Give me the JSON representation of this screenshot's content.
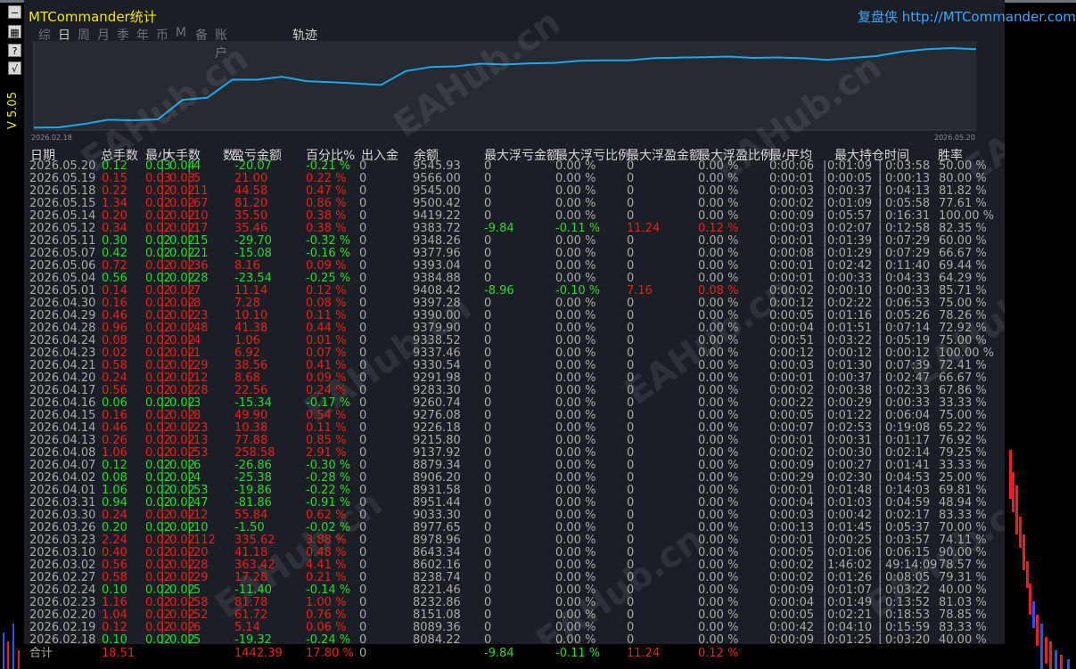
{
  "app": {
    "title": "MTCommander统计",
    "site": "复盘侠 http://MTCommander.com",
    "version": "V 5.05"
  },
  "toolbar": {
    "buttons": [
      {
        "name": "minimize-button",
        "glyph": "−"
      },
      {
        "name": "grid-button",
        "glyph": "▦"
      },
      {
        "name": "help-button",
        "glyph": "?"
      },
      {
        "name": "chart-button",
        "glyph": "√"
      }
    ]
  },
  "nav": {
    "tabs": [
      "综",
      "日",
      "周",
      "月",
      "季",
      "年",
      "币",
      "M",
      "备",
      "账户"
    ],
    "active_index": 1
  },
  "chart_data": {
    "type": "line",
    "title": "轨迹",
    "x_start_label": "2026.02.18",
    "x_end_label": "2026.05.20",
    "ylim": [
      8040,
      9600
    ],
    "series": [
      {
        "color": "#1aa8f0",
        "values": [
          8084.22,
          8089.36,
          8151.08,
          8232.86,
          8221.46,
          8238.74,
          8602.16,
          8643.34,
          8978.96,
          8977.65,
          9033.3,
          8951.44,
          8931.58,
          8906.2,
          8879.34,
          9137.92,
          9215.8,
          9226.18,
          9276.08,
          9260.74,
          9283.3,
          9291.98,
          9330.54,
          9337.46,
          9338.52,
          9379.9,
          9390.0,
          9397.28,
          9408.42,
          9384.88,
          9393.04,
          9377.96,
          9348.26,
          9383.72,
          9419.22,
          9500.42,
          9545.0,
          9566.0,
          9545.93
        ]
      }
    ]
  },
  "table": {
    "headers": [
      "日期",
      "总手数",
      "最小",
      "大手数",
      "数",
      "盈亏金额",
      "百分比%",
      "出入金",
      "余额",
      "最大浮亏金额",
      "最大浮亏比例",
      "最大浮盈金额",
      "最大浮盈比例",
      "最小",
      "平均",
      "最大持仓时间",
      "胜率"
    ],
    "rows": [
      {
        "date": "2026.05.20",
        "lots": "0.12",
        "min": "0.03",
        "max": "0.04",
        "n": "4",
        "pnl": "-20.07",
        "pct": "-0.21 %",
        "io": "0",
        "bal": "9545.93",
        "fl": "0",
        "flp": "0.00 %",
        "fp": "0",
        "fpp": "0.00 %",
        "tmin": "0:00:06",
        "tavg": "0:01:09",
        "tmax": "0:03:58",
        "win": "50.00 %",
        "c": "g"
      },
      {
        "date": "2026.05.19",
        "lots": "0.15",
        "min": "0.03",
        "max": "0.03",
        "n": "5",
        "pnl": "21.00",
        "pct": "0.22 %",
        "io": "0",
        "bal": "9566.00",
        "fl": "0",
        "flp": "0.00 %",
        "fp": "0",
        "fpp": "0.00 %",
        "tmin": "0:00:01",
        "tavg": "0:00:05",
        "tmax": "0:00:13",
        "win": "80.00 %",
        "c": "r"
      },
      {
        "date": "2026.05.18",
        "lots": "0.22",
        "min": "0.02",
        "max": "0.02",
        "n": "11",
        "pnl": "44.58",
        "pct": "0.47 %",
        "io": "0",
        "bal": "9545.00",
        "fl": "0",
        "flp": "0.00 %",
        "fp": "0",
        "fpp": "0.00 %",
        "tmin": "0:00:03",
        "tavg": "0:00:37",
        "tmax": "0:04:13",
        "win": "81.82 %",
        "c": "r"
      },
      {
        "date": "2026.05.15",
        "lots": "1.34",
        "min": "0.02",
        "max": "0.02",
        "n": "67",
        "pnl": "81.20",
        "pct": "0.86 %",
        "io": "0",
        "bal": "9500.42",
        "fl": "0",
        "flp": "0.00 %",
        "fp": "0",
        "fpp": "0.00 %",
        "tmin": "0:00:02",
        "tavg": "0:01:09",
        "tmax": "0:05:58",
        "win": "77.61 %",
        "c": "r"
      },
      {
        "date": "2026.05.14",
        "lots": "0.20",
        "min": "0.02",
        "max": "0.02",
        "n": "10",
        "pnl": "35.50",
        "pct": "0.38 %",
        "io": "0",
        "bal": "9419.22",
        "fl": "0",
        "flp": "0.00 %",
        "fp": "0",
        "fpp": "0.00 %",
        "tmin": "0:00:09",
        "tavg": "0:05:57",
        "tmax": "0:16:31",
        "win": "100.00 %",
        "c": "r"
      },
      {
        "date": "2026.05.12",
        "lots": "0.34",
        "min": "0.02",
        "max": "0.02",
        "n": "17",
        "pnl": "35.46",
        "pct": "0.38 %",
        "io": "0",
        "bal": "9383.72",
        "fl": "-9.84",
        "flp": "-0.11 %",
        "fp": "11.24",
        "fpp": "0.12 %",
        "tmin": "0:00:03",
        "tavg": "0:02:07",
        "tmax": "0:12:58",
        "win": "82.35 %",
        "c": "r"
      },
      {
        "date": "2026.05.11",
        "lots": "0.30",
        "min": "0.02",
        "max": "0.02",
        "n": "15",
        "pnl": "-29.70",
        "pct": "-0.32 %",
        "io": "0",
        "bal": "9348.26",
        "fl": "0",
        "flp": "0.00 %",
        "fp": "0",
        "fpp": "0.00 %",
        "tmin": "0:00:01",
        "tavg": "0:01:39",
        "tmax": "0:07:29",
        "win": "60.00 %",
        "c": "g"
      },
      {
        "date": "2026.05.07",
        "lots": "0.42",
        "min": "0.02",
        "max": "0.02",
        "n": "21",
        "pnl": "-15.08",
        "pct": "-0.16 %",
        "io": "0",
        "bal": "9377.96",
        "fl": "0",
        "flp": "0.00 %",
        "fp": "0",
        "fpp": "0.00 %",
        "tmin": "0:00:08",
        "tavg": "0:01:29",
        "tmax": "0:07:29",
        "win": "66.67 %",
        "c": "g"
      },
      {
        "date": "2026.05.06",
        "lots": "0.72",
        "min": "0.02",
        "max": "0.02",
        "n": "36",
        "pnl": "8.16",
        "pct": "0.09 %",
        "io": "0",
        "bal": "9393.04",
        "fl": "0",
        "flp": "0.00 %",
        "fp": "0",
        "fpp": "0.00 %",
        "tmin": "0:00:01",
        "tavg": "0:02:42",
        "tmax": "0:11:40",
        "win": "69.44 %",
        "c": "r"
      },
      {
        "date": "2026.05.04",
        "lots": "0.56",
        "min": "0.02",
        "max": "0.02",
        "n": "28",
        "pnl": "-23.54",
        "pct": "-0.25 %",
        "io": "0",
        "bal": "9384.88",
        "fl": "0",
        "flp": "0.00 %",
        "fp": "0",
        "fpp": "0.00 %",
        "tmin": "0:00:01",
        "tavg": "0:00:33",
        "tmax": "0:04:33",
        "win": "64.29 %",
        "c": "g"
      },
      {
        "date": "2026.05.01",
        "lots": "0.14",
        "min": "0.02",
        "max": "0.02",
        "n": "7",
        "pnl": "11.14",
        "pct": "0.12 %",
        "io": "0",
        "bal": "9408.42",
        "fl": "-8.96",
        "flp": "-0.10 %",
        "fp": "7.16",
        "fpp": "0.08 %",
        "tmin": "0:00:02",
        "tavg": "0:00:10",
        "tmax": "0:00:33",
        "win": "85.71 %",
        "c": "r"
      },
      {
        "date": "2026.04.30",
        "lots": "0.16",
        "min": "0.02",
        "max": "0.02",
        "n": "8",
        "pnl": "7.28",
        "pct": "0.08 %",
        "io": "0",
        "bal": "9397.28",
        "fl": "0",
        "flp": "0.00 %",
        "fp": "0",
        "fpp": "0.00 %",
        "tmin": "0:00:12",
        "tavg": "0:02:22",
        "tmax": "0:06:53",
        "win": "75.00 %",
        "c": "r"
      },
      {
        "date": "2026.04.29",
        "lots": "0.46",
        "min": "0.02",
        "max": "0.02",
        "n": "23",
        "pnl": "10.10",
        "pct": "0.11 %",
        "io": "0",
        "bal": "9390.00",
        "fl": "0",
        "flp": "0.00 %",
        "fp": "0",
        "fpp": "0.00 %",
        "tmin": "0:00:05",
        "tavg": "0:01:16",
        "tmax": "0:05:26",
        "win": "78.26 %",
        "c": "r"
      },
      {
        "date": "2026.04.28",
        "lots": "0.96",
        "min": "0.02",
        "max": "0.02",
        "n": "48",
        "pnl": "41.38",
        "pct": "0.44 %",
        "io": "0",
        "bal": "9379.90",
        "fl": "0",
        "flp": "0.00 %",
        "fp": "0",
        "fpp": "0.00 %",
        "tmin": "0:00:04",
        "tavg": "0:01:51",
        "tmax": "0:07:14",
        "win": "72.92 %",
        "c": "r"
      },
      {
        "date": "2026.04.24",
        "lots": "0.08",
        "min": "0.02",
        "max": "0.02",
        "n": "4",
        "pnl": "1.06",
        "pct": "0.01 %",
        "io": "0",
        "bal": "9338.52",
        "fl": "0",
        "flp": "0.00 %",
        "fp": "0",
        "fpp": "0.00 %",
        "tmin": "0:00:51",
        "tavg": "0:03:22",
        "tmax": "0:05:19",
        "win": "75.00 %",
        "c": "r"
      },
      {
        "date": "2026.04.23",
        "lots": "0.02",
        "min": "0.02",
        "max": "0.02",
        "n": "1",
        "pnl": "6.92",
        "pct": "0.07 %",
        "io": "0",
        "bal": "9337.46",
        "fl": "0",
        "flp": "0.00 %",
        "fp": "0",
        "fpp": "0.00 %",
        "tmin": "0:00:12",
        "tavg": "0:00:12",
        "tmax": "0:00:12",
        "win": "100.00 %",
        "c": "r"
      },
      {
        "date": "2026.04.21",
        "lots": "0.58",
        "min": "0.02",
        "max": "0.02",
        "n": "29",
        "pnl": "38.56",
        "pct": "0.41 %",
        "io": "0",
        "bal": "9330.54",
        "fl": "0",
        "flp": "0.00 %",
        "fp": "0",
        "fpp": "0.00 %",
        "tmin": "0:00:03",
        "tavg": "0:01:30",
        "tmax": "0:07:39",
        "win": "72.41 %",
        "c": "r"
      },
      {
        "date": "2026.04.20",
        "lots": "0.24",
        "min": "0.02",
        "max": "0.02",
        "n": "12",
        "pnl": "8.68",
        "pct": "0.09 %",
        "io": "0",
        "bal": "9291.98",
        "fl": "0",
        "flp": "0.00 %",
        "fp": "0",
        "fpp": "0.00 %",
        "tmin": "0:00:01",
        "tavg": "0:00:37",
        "tmax": "0:02:47",
        "win": "66.67 %",
        "c": "r"
      },
      {
        "date": "2026.04.17",
        "lots": "0.56",
        "min": "0.02",
        "max": "0.02",
        "n": "28",
        "pnl": "22.56",
        "pct": "0.24 %",
        "io": "0",
        "bal": "9283.30",
        "fl": "0",
        "flp": "0.00 %",
        "fp": "0",
        "fpp": "0.00 %",
        "tmin": "0:00:02",
        "tavg": "0:00:38",
        "tmax": "0:02:33",
        "win": "67.86 %",
        "c": "r"
      },
      {
        "date": "2026.04.16",
        "lots": "0.06",
        "min": "0.02",
        "max": "0.02",
        "n": "3",
        "pnl": "-15.34",
        "pct": "-0.17 %",
        "io": "0",
        "bal": "9260.74",
        "fl": "0",
        "flp": "0.00 %",
        "fp": "0",
        "fpp": "0.00 %",
        "tmin": "0:00:22",
        "tavg": "0:00:29",
        "tmax": "0:00:33",
        "win": "33.33 %",
        "c": "g"
      },
      {
        "date": "2026.04.15",
        "lots": "0.16",
        "min": "0.02",
        "max": "0.02",
        "n": "8",
        "pnl": "49.90",
        "pct": "0.54 %",
        "io": "0",
        "bal": "9276.08",
        "fl": "0",
        "flp": "0.00 %",
        "fp": "0",
        "fpp": "0.00 %",
        "tmin": "0:00:05",
        "tavg": "0:01:22",
        "tmax": "0:06:04",
        "win": "75.00 %",
        "c": "r"
      },
      {
        "date": "2026.04.14",
        "lots": "0.46",
        "min": "0.02",
        "max": "0.02",
        "n": "23",
        "pnl": "10.38",
        "pct": "0.11 %",
        "io": "0",
        "bal": "9226.18",
        "fl": "0",
        "flp": "0.00 %",
        "fp": "0",
        "fpp": "0.00 %",
        "tmin": "0:00:07",
        "tavg": "0:02:53",
        "tmax": "0:19:08",
        "win": "65.22 %",
        "c": "r"
      },
      {
        "date": "2026.04.13",
        "lots": "0.26",
        "min": "0.02",
        "max": "0.02",
        "n": "13",
        "pnl": "77.88",
        "pct": "0.85 %",
        "io": "0",
        "bal": "9215.80",
        "fl": "0",
        "flp": "0.00 %",
        "fp": "0",
        "fpp": "0.00 %",
        "tmin": "0:00:01",
        "tavg": "0:00:31",
        "tmax": "0:01:17",
        "win": "76.92 %",
        "c": "r"
      },
      {
        "date": "2026.04.08",
        "lots": "1.06",
        "min": "0.02",
        "max": "0.02",
        "n": "53",
        "pnl": "258.58",
        "pct": "2.91 %",
        "io": "0",
        "bal": "9137.92",
        "fl": "0",
        "flp": "0.00 %",
        "fp": "0",
        "fpp": "0.00 %",
        "tmin": "0:00:02",
        "tavg": "0:00:30",
        "tmax": "0:02:14",
        "win": "79.25 %",
        "c": "r"
      },
      {
        "date": "2026.04.07",
        "lots": "0.12",
        "min": "0.02",
        "max": "0.02",
        "n": "6",
        "pnl": "-26.86",
        "pct": "-0.30 %",
        "io": "0",
        "bal": "8879.34",
        "fl": "0",
        "flp": "0.00 %",
        "fp": "0",
        "fpp": "0.00 %",
        "tmin": "0:00:09",
        "tavg": "0:00:27",
        "tmax": "0:01:41",
        "win": "33.33 %",
        "c": "g"
      },
      {
        "date": "2026.04.02",
        "lots": "0.08",
        "min": "0.02",
        "max": "0.02",
        "n": "4",
        "pnl": "-25.38",
        "pct": "-0.28 %",
        "io": "0",
        "bal": "8906.20",
        "fl": "0",
        "flp": "0.00 %",
        "fp": "0",
        "fpp": "0.00 %",
        "tmin": "0:00:29",
        "tavg": "0:02:30",
        "tmax": "0:04:53",
        "win": "25.00 %",
        "c": "g"
      },
      {
        "date": "2026.04.01",
        "lots": "1.06",
        "min": "0.02",
        "max": "0.02",
        "n": "53",
        "pnl": "-19.86",
        "pct": "-0.22 %",
        "io": "0",
        "bal": "8931.58",
        "fl": "0",
        "flp": "0.00 %",
        "fp": "0",
        "fpp": "0.00 %",
        "tmin": "0:00:01",
        "tavg": "0:01:48",
        "tmax": "0:14:03",
        "win": "69.81 %",
        "c": "g"
      },
      {
        "date": "2026.03.31",
        "lots": "0.94",
        "min": "0.02",
        "max": "0.02",
        "n": "47",
        "pnl": "-81.86",
        "pct": "-0.91 %",
        "io": "0",
        "bal": "8951.44",
        "fl": "0",
        "flp": "0.00 %",
        "fp": "0",
        "fpp": "0.00 %",
        "tmin": "0:00:04",
        "tavg": "0:01:03",
        "tmax": "0:04:59",
        "win": "48.94 %",
        "c": "g"
      },
      {
        "date": "2026.03.30",
        "lots": "0.24",
        "min": "0.02",
        "max": "0.02",
        "n": "12",
        "pnl": "55.84",
        "pct": "0.62 %",
        "io": "0",
        "bal": "9033.30",
        "fl": "0",
        "flp": "0.00 %",
        "fp": "0",
        "fpp": "0.00 %",
        "tmin": "0:00:03",
        "tavg": "0:00:42",
        "tmax": "0:02:17",
        "win": "83.33 %",
        "c": "r"
      },
      {
        "date": "2026.03.26",
        "lots": "0.20",
        "min": "0.02",
        "max": "0.02",
        "n": "10",
        "pnl": "-1.50",
        "pct": "-0.02 %",
        "io": "0",
        "bal": "8977.65",
        "fl": "0",
        "flp": "0.00 %",
        "fp": "0",
        "fpp": "0.00 %",
        "tmin": "0:00:13",
        "tavg": "0:01:45",
        "tmax": "0:05:37",
        "win": "70.00 %",
        "c": "g"
      },
      {
        "date": "2026.03.23",
        "lots": "2.24",
        "min": "0.02",
        "max": "0.02",
        "n": "112",
        "pnl": "335.62",
        "pct": "3.88 %",
        "io": "0",
        "bal": "8978.96",
        "fl": "0",
        "flp": "0.00 %",
        "fp": "0",
        "fpp": "0.00 %",
        "tmin": "0:00:01",
        "tavg": "0:00:25",
        "tmax": "0:03:57",
        "win": "74.11 %",
        "c": "r"
      },
      {
        "date": "2026.03.10",
        "lots": "0.40",
        "min": "0.02",
        "max": "0.02",
        "n": "20",
        "pnl": "41.18",
        "pct": "0.48 %",
        "io": "0",
        "bal": "8643.34",
        "fl": "0",
        "flp": "0.00 %",
        "fp": "0",
        "fpp": "0.00 %",
        "tmin": "0:00:05",
        "tavg": "0:01:06",
        "tmax": "0:06:15",
        "win": "90.00 %",
        "c": "r"
      },
      {
        "date": "2026.03.02",
        "lots": "0.56",
        "min": "0.02",
        "max": "0.02",
        "n": "28",
        "pnl": "363.42",
        "pct": "4.41 %",
        "io": "0",
        "bal": "8602.16",
        "fl": "0",
        "flp": "0.00 %",
        "fp": "0",
        "fpp": "0.00 %",
        "tmin": "0:00:02",
        "tavg": "1:46:02",
        "tmax": "49:14:09",
        "win": "78.57 %",
        "c": "r"
      },
      {
        "date": "2026.02.27",
        "lots": "0.58",
        "min": "0.02",
        "max": "0.02",
        "n": "29",
        "pnl": "17.28",
        "pct": "0.21 %",
        "io": "0",
        "bal": "8238.74",
        "fl": "0",
        "flp": "0.00 %",
        "fp": "0",
        "fpp": "0.00 %",
        "tmin": "0:00:02",
        "tavg": "0:01:26",
        "tmax": "0:08:05",
        "win": "79.31 %",
        "c": "r"
      },
      {
        "date": "2026.02.24",
        "lots": "0.10",
        "min": "0.02",
        "max": "0.02",
        "n": "5",
        "pnl": "-11.40",
        "pct": "-0.14 %",
        "io": "0",
        "bal": "8221.46",
        "fl": "0",
        "flp": "0.00 %",
        "fp": "0",
        "fpp": "0.00 %",
        "tmin": "0:00:09",
        "tavg": "0:01:07",
        "tmax": "0:03:22",
        "win": "40.00 %",
        "c": "g"
      },
      {
        "date": "2026.02.23",
        "lots": "1.16",
        "min": "0.02",
        "max": "0.02",
        "n": "58",
        "pnl": "81.78",
        "pct": "1.00 %",
        "io": "0",
        "bal": "8232.86",
        "fl": "0",
        "flp": "0.00 %",
        "fp": "0",
        "fpp": "0.00 %",
        "tmin": "0:00:04",
        "tavg": "0:01:49",
        "tmax": "0:13:52",
        "win": "81.03 %",
        "c": "r"
      },
      {
        "date": "2026.02.20",
        "lots": "1.04",
        "min": "0.02",
        "max": "0.02",
        "n": "52",
        "pnl": "61.72",
        "pct": "0.76 %",
        "io": "0",
        "bal": "8151.08",
        "fl": "0",
        "flp": "0.00 %",
        "fp": "0",
        "fpp": "0.00 %",
        "tmin": "0:00:05",
        "tavg": "0:02:21",
        "tmax": "0:18:53",
        "win": "78.85 %",
        "c": "r"
      },
      {
        "date": "2026.02.19",
        "lots": "0.12",
        "min": "0.02",
        "max": "0.02",
        "n": "6",
        "pnl": "5.14",
        "pct": "0.06 %",
        "io": "0",
        "bal": "8089.36",
        "fl": "0",
        "flp": "0.00 %",
        "fp": "0",
        "fpp": "0.00 %",
        "tmin": "0:00:42",
        "tavg": "0:04:10",
        "tmax": "0:15:59",
        "win": "83.33 %",
        "c": "r"
      },
      {
        "date": "2026.02.18",
        "lots": "0.10",
        "min": "0.02",
        "max": "0.02",
        "n": "5",
        "pnl": "-19.32",
        "pct": "-0.24 %",
        "io": "0",
        "bal": "8084.22",
        "fl": "0",
        "flp": "0.00 %",
        "fp": "0",
        "fpp": "0.00 %",
        "tmin": "0:00:09",
        "tavg": "0:01:25",
        "tmax": "0:03:20",
        "win": "40.00 %",
        "c": "g"
      }
    ],
    "totals": {
      "label": "合计",
      "lots": "18.51",
      "pnl": "1442.39",
      "pct": "17.80 %",
      "io": "0",
      "fl": "-9.84",
      "flp": "-0.11 %",
      "fp": "11.24",
      "fpp": "0.12 %"
    }
  },
  "watermark": "EAHub.cn",
  "colors": {
    "accent_title": "#f5e800",
    "link": "#39a8ff",
    "profit_red": "#e8201b",
    "loss_green": "#22dd22",
    "line": "#1aa8f0",
    "panel_bg": "#1b1e24"
  }
}
